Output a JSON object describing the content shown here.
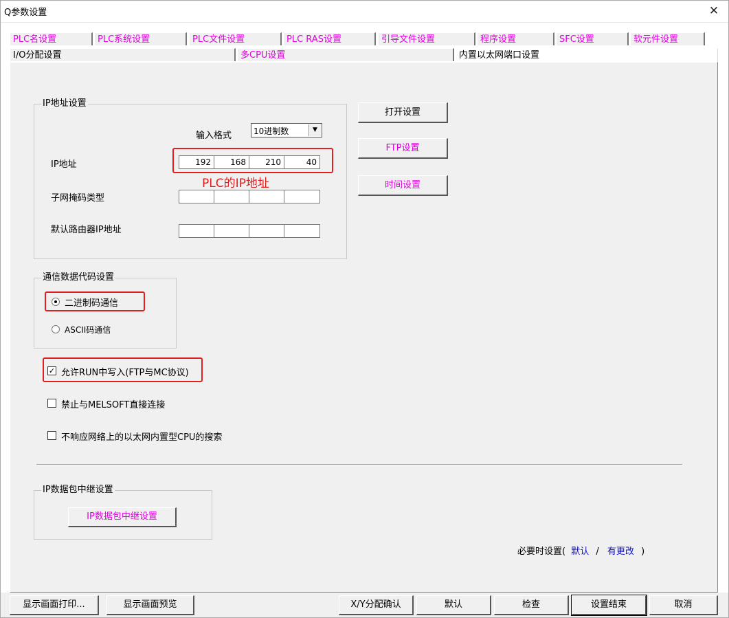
{
  "window": {
    "title": "Q参数设置",
    "close_glyph": "✕"
  },
  "tabs_row1": [
    {
      "label": "PLC名设置"
    },
    {
      "label": "PLC系统设置"
    },
    {
      "label": "PLC文件设置"
    },
    {
      "label": "PLC RAS设置"
    },
    {
      "label": "引导文件设置"
    },
    {
      "label": "程序设置"
    },
    {
      "label": "SFC设置"
    },
    {
      "label": "软元件设置"
    }
  ],
  "tabs_row2": [
    {
      "label": "I/O分配设置"
    },
    {
      "label": "多CPU设置"
    },
    {
      "label": "内置以太网端口设置"
    }
  ],
  "ip_group": {
    "title": "IP地址设置",
    "input_format_label": "输入格式",
    "input_format_value": "10进制数",
    "ip_label": "IP地址",
    "ip_values": [
      "192",
      "168",
      "210",
      "40"
    ],
    "subnet_label": "子网掩码类型",
    "subnet_values": [
      "",
      "",
      "",
      ""
    ],
    "gateway_label": "默认路由器IP地址",
    "gateway_values": [
      "",
      "",
      "",
      ""
    ]
  },
  "annotation_ip": "PLC的IP地址",
  "right_buttons": {
    "open": "打开设置",
    "ftp": "FTP设置",
    "time": "时间设置"
  },
  "comm_group": {
    "title": "通信数据代码设置",
    "binary": "二进制码通信",
    "ascii": "ASCII码通信",
    "selected": "binary"
  },
  "checkboxes": [
    {
      "label": "允许RUN中写入(FTP与MC协议)",
      "checked": true
    },
    {
      "label": "禁止与MELSOFT直接连接",
      "checked": false
    },
    {
      "label": "不响应网络上的以太网内置型CPU的搜索",
      "checked": false
    }
  ],
  "relay_group": {
    "title": "IP数据包中继设置",
    "button": "IP数据包中继设置"
  },
  "footer_note": {
    "prefix": "必要时设置(",
    "default": "默认",
    "slash": "/",
    "changed": "有更改",
    "suffix": ")"
  },
  "bottom_buttons": {
    "print": "显示画面打印...",
    "preview": "显示画面预览",
    "xy": "X/Y分配确认",
    "default": "默认",
    "check": "检查",
    "finish": "设置结束",
    "cancel": "取消"
  },
  "colors": {
    "tab_text": "#e000e0",
    "annotation": "#e02020",
    "link": "#1010c8"
  }
}
